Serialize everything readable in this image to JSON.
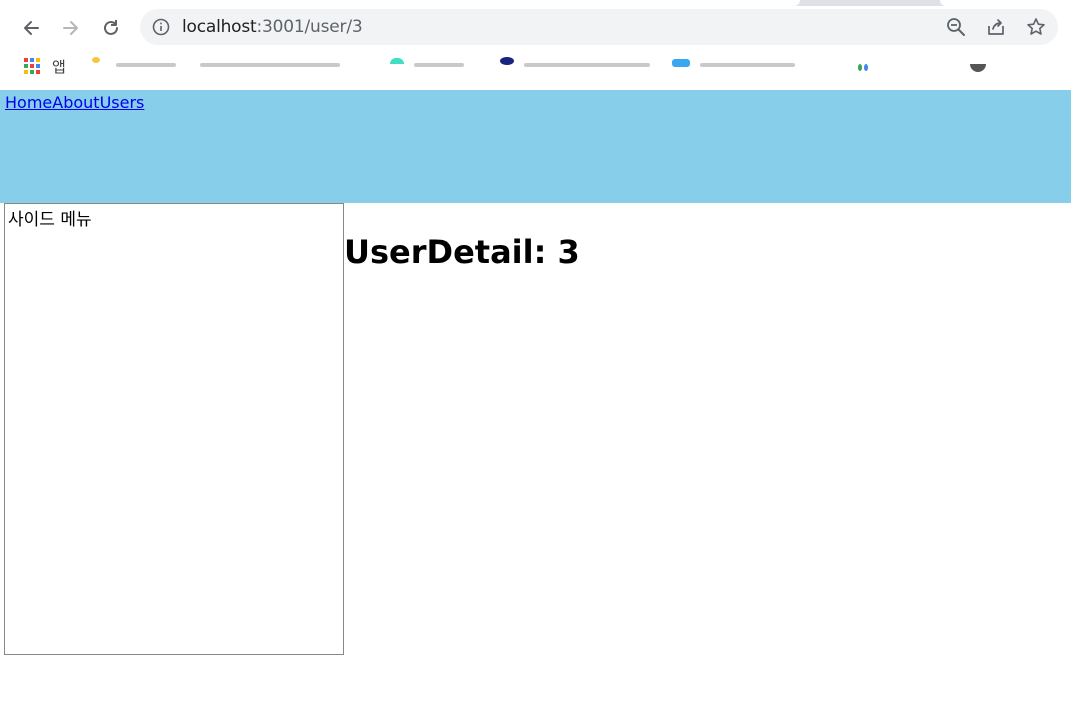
{
  "browser": {
    "url_host": "localhost",
    "url_path": ":3001/user/3",
    "bookmarks": {
      "apps_label": "앱"
    }
  },
  "colors": {
    "header_bg": "#87ceeb",
    "link": "#0000ee",
    "sidebar_border": "#888888"
  },
  "nav": {
    "links": [
      {
        "label": "Home"
      },
      {
        "label": "About"
      },
      {
        "label": "Users"
      }
    ]
  },
  "sidebar": {
    "title": "사이드 메뉴"
  },
  "main": {
    "title": "UserDetail: 3"
  },
  "icons": {
    "back": "arrow-left-icon",
    "forward": "arrow-right-icon",
    "reload": "reload-icon",
    "info": "info-icon",
    "zoom": "zoom-out-icon",
    "share": "share-icon",
    "star": "star-icon",
    "apps": "apps-grid-icon"
  }
}
